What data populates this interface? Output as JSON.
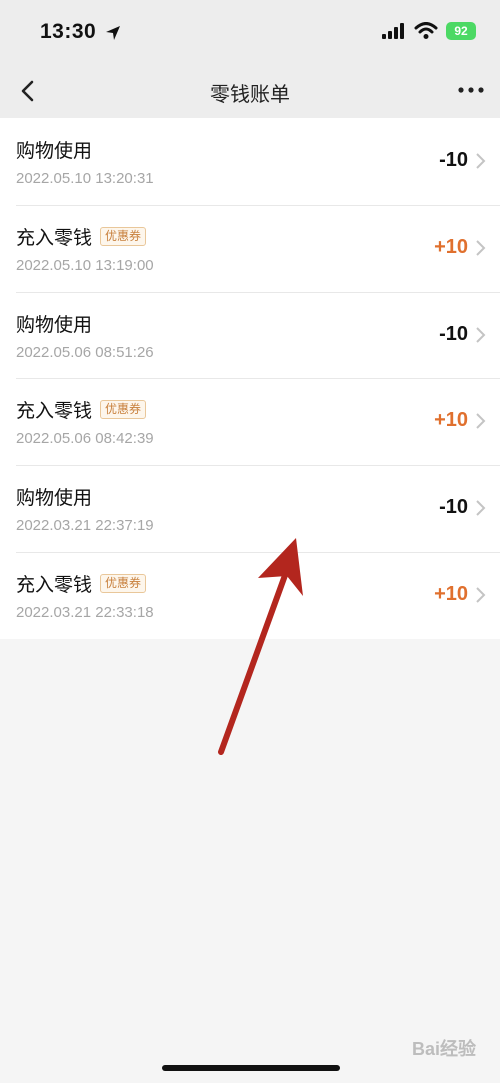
{
  "status": {
    "time": "13:30",
    "battery": "92"
  },
  "nav": {
    "title": "零钱账单"
  },
  "transactions": [
    {
      "title": "购物使用",
      "badge": "",
      "time": "2022.05.10 13:20:31",
      "amount": "-10",
      "type": "expense"
    },
    {
      "title": "充入零钱",
      "badge": "优惠券",
      "time": "2022.05.10 13:19:00",
      "amount": "+10",
      "type": "income"
    },
    {
      "title": "购物使用",
      "badge": "",
      "time": "2022.05.06 08:51:26",
      "amount": "-10",
      "type": "expense"
    },
    {
      "title": "充入零钱",
      "badge": "优惠券",
      "time": "2022.05.06 08:42:39",
      "amount": "+10",
      "type": "income"
    },
    {
      "title": "购物使用",
      "badge": "",
      "time": "2022.03.21 22:37:19",
      "amount": "-10",
      "type": "expense"
    },
    {
      "title": "充入零钱",
      "badge": "优惠券",
      "time": "2022.03.21 22:33:18",
      "amount": "+10",
      "type": "income"
    }
  ],
  "colors": {
    "income": "#e0702e",
    "expense": "#111111",
    "annotation_arrow": "#b3261e"
  },
  "watermark": "Bai经验"
}
